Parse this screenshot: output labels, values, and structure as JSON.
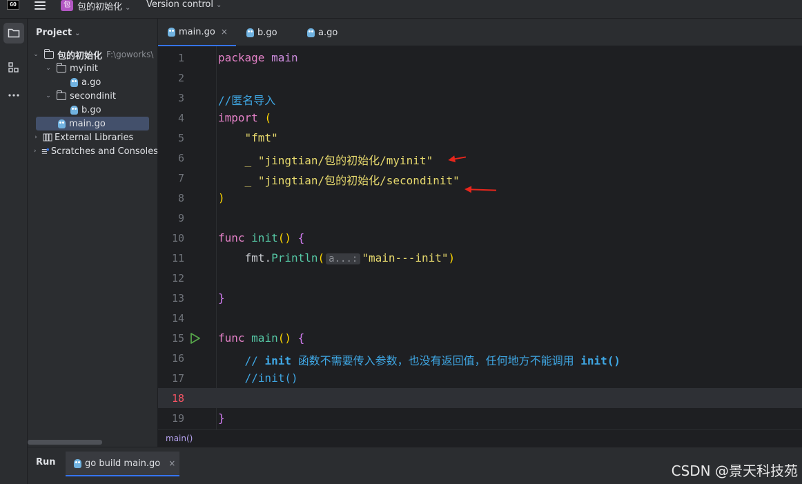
{
  "titlebar": {
    "logo": "GO",
    "project_badge": "包",
    "project_name": "包的初始化",
    "vcs_label": "Version control"
  },
  "icons": {
    "menu": "hamburger-icon",
    "project_tool": "folder-icon",
    "structure_tool": "structure-icon",
    "more_tool": "more-icon",
    "go_file": "gopher-file-icon"
  },
  "project": {
    "header": "Project",
    "tree": [
      {
        "label": "包的初始化",
        "hint": "F:\\goworks\\",
        "type": "folder",
        "depth": 0,
        "expanded": true
      },
      {
        "label": "myinit",
        "type": "folder",
        "depth": 1,
        "expanded": true
      },
      {
        "label": "a.go",
        "type": "go",
        "depth": 2
      },
      {
        "label": "secondinit",
        "type": "folder",
        "depth": 1,
        "expanded": true
      },
      {
        "label": "b.go",
        "type": "go",
        "depth": 2
      },
      {
        "label": "main.go",
        "type": "go",
        "depth": 1,
        "selected": true
      },
      {
        "label": "External Libraries",
        "type": "lib",
        "depth": 0
      },
      {
        "label": "Scratches and Consoles",
        "type": "scratch",
        "depth": 0
      }
    ]
  },
  "tabs": [
    {
      "label": "main.go",
      "active": true,
      "close": "×"
    },
    {
      "label": "b.go"
    },
    {
      "label": "a.go"
    }
  ],
  "editor": {
    "current_line": 18,
    "lines": [
      "1",
      "2",
      "3",
      "4",
      "5",
      "6",
      "7",
      "8",
      "9",
      "10",
      "11",
      "12",
      "13",
      "14",
      "15",
      "16",
      "17",
      "18",
      "19"
    ],
    "code": {
      "l1_kw": "package",
      "l1_name": "main",
      "l3": "//匿名导入",
      "l4_kw": "import",
      "l4_paren": "(",
      "l5": "\"fmt\"",
      "l6_blank": "_",
      "l6_str": "\"jingtian/包的初始化/myinit\"",
      "l7_blank": "_",
      "l7_str": "\"jingtian/包的初始化/secondinit\"",
      "l8": ")",
      "l10_kw": "func",
      "l10_fn": "init",
      "l10_parens": "()",
      "l10_brace": "{",
      "l11_pkg": "fmt",
      "l11_dot": ".",
      "l11_fn": "Println",
      "l11_open": "(",
      "l11_hint": "a...:",
      "l11_str": "\"main---init\"",
      "l11_close": ")",
      "l13": "}",
      "l15_kw": "func",
      "l15_fn": "main",
      "l15_parens": "()",
      "l15_brace": "{",
      "l16_a": "// ",
      "l16_b": "init",
      "l16_c": " 函数不需要传入参数，也没有返回值，任何地方不能调用 ",
      "l16_d": "init()",
      "l17_a": "//",
      "l17_b": "init()",
      "l19": "}"
    }
  },
  "breadcrumb": "main()",
  "run_panel": {
    "title": "Run",
    "tab_label": "go build main.go",
    "close": "×"
  },
  "watermark": "CSDN @景天科技苑",
  "colors": {
    "accent": "#3574f0",
    "arrow": "#e8261c",
    "keyword": "#cf8ee0",
    "string": "#e6d86d",
    "comment": "#3fa7e4"
  }
}
